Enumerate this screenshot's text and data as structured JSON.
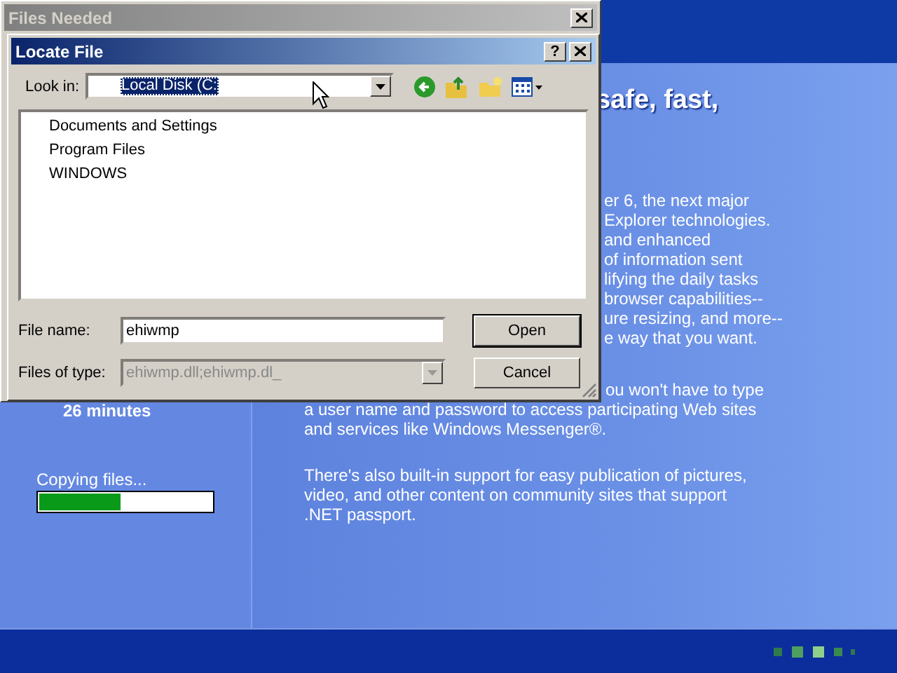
{
  "setup_panel": {
    "time_remaining": "26 minutes",
    "status": "Copying files...",
    "progress": {
      "level": 0.47
    }
  },
  "content": {
    "heading_fragment": "safe, fast,",
    "paragraph_fragments": [
      "er 6, the next major",
      "Explorer technologies.",
      "and enhanced",
      "of information sent",
      "lifying the daily tasks",
      "browser capabilities--",
      "ure resizing, and more--",
      "e way that you want."
    ],
    "paragraph_1_fragment": "ou won't have to type",
    "paragraph_1_lines": [
      "a user name and password to access participating Web sites",
      "and services like Windows Messenger®."
    ],
    "paragraph_2_lines": [
      "There's also built-in support for easy publication of pictures,",
      "video, and other content on community sites that support",
      ".NET passport."
    ]
  },
  "files_needed_window": {
    "title": "Files Needed",
    "active": false
  },
  "locate_file_dialog": {
    "title": "Locate File",
    "help_button": "?",
    "look_in": {
      "label": "Look in:",
      "value": "Local Disk (C:"
    },
    "files": [
      "Documents and Settings",
      "Program Files",
      "WINDOWS"
    ],
    "file_name": {
      "label": "File name:",
      "value": "ehiwmp"
    },
    "files_of_type": {
      "label": "Files of type:",
      "value": "ehiwmp.dll;ehiwmp.dl_",
      "disabled": true
    },
    "buttons": [
      {
        "label": "Open",
        "default": true
      },
      {
        "label": "Cancel",
        "default": false
      }
    ]
  }
}
